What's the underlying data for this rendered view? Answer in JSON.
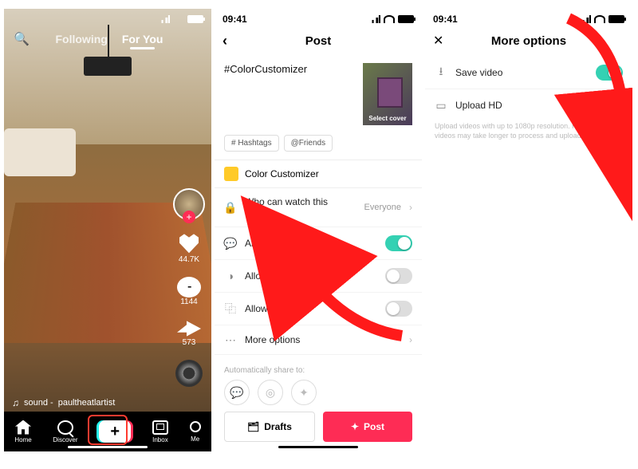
{
  "status_time": "09:41",
  "screen1": {
    "tab_following": "Following",
    "tab_foryou": "For You",
    "likes": "44.7K",
    "comments": "1144",
    "shares": "573",
    "sound_prefix": "sound -",
    "sound_author": "paultheatlartist",
    "nav": {
      "home": "Home",
      "discover": "Discover",
      "inbox": "Inbox",
      "me": "Me"
    }
  },
  "screen2": {
    "title": "Post",
    "caption": "#ColorCustomizer",
    "cover_label": "Select cover",
    "chip_hashtags": "# Hashtags",
    "chip_friends": "@Friends",
    "effect": "Color Customizer",
    "row_privacy": "Who can watch this video",
    "row_privacy_value": "Everyone",
    "row_comments": "Allow comments",
    "row_duet": "Allow Duet",
    "row_stitch": "Allow Stitch",
    "row_more": "More options",
    "share_label": "Automatically share to:",
    "drafts": "Drafts",
    "post": "Post"
  },
  "screen3": {
    "title": "More options",
    "row_save": "Save video",
    "row_hd": "Upload HD",
    "hd_sub": "Upload videos with up to 1080p resolution. High-resolution videos may take longer to process and upload."
  }
}
